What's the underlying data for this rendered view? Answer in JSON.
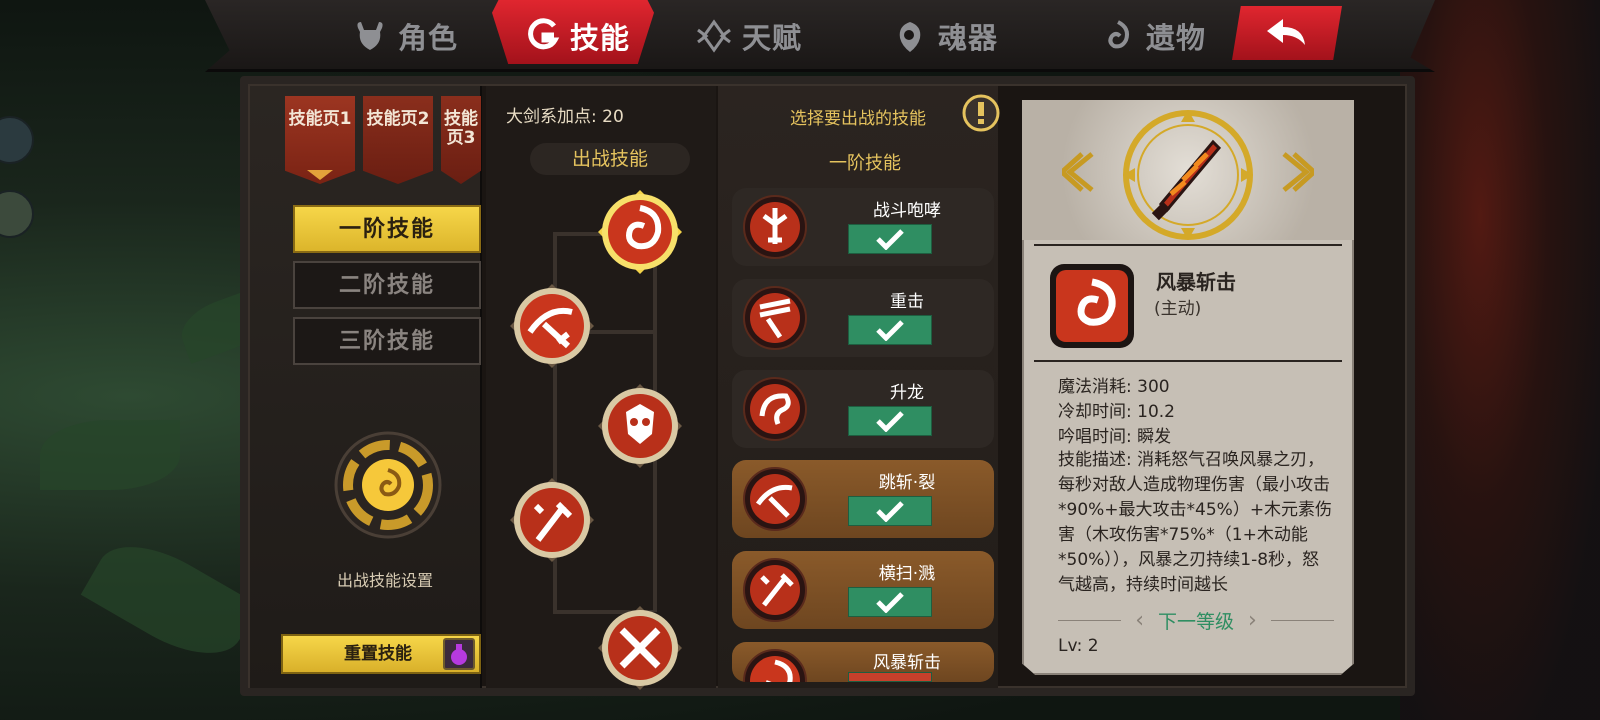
{
  "nav": {
    "tabs": [
      {
        "label": "角色",
        "icon": "horned-helmet-icon"
      },
      {
        "label": "技能",
        "icon": "skill-g-icon"
      },
      {
        "label": "天赋",
        "icon": "crystal-icon"
      },
      {
        "label": "魂器",
        "icon": "soul-drop-icon"
      },
      {
        "label": "遗物",
        "icon": "relic-swirl-icon"
      }
    ],
    "active_tab": "技能",
    "back_icon": "back-arrow-icon"
  },
  "left": {
    "pages": [
      {
        "label": "技能页1",
        "selected": true
      },
      {
        "label": "技能页2",
        "selected": false
      },
      {
        "label": "技能页3",
        "selected": false,
        "locked": true
      }
    ],
    "tiers": [
      {
        "label": "一阶技能",
        "selected": true
      },
      {
        "label": "二阶技能",
        "selected": false
      },
      {
        "label": "三阶技能",
        "selected": false
      }
    ],
    "battle_settings_label": "出战技能设置",
    "reset_label": "重置技能",
    "reset_icon": "potion-icon"
  },
  "tree": {
    "points_text": "大剑系加点: 20",
    "battle_header": "出战技能"
  },
  "list": {
    "select_text": "选择要出战的技能",
    "tier_title": "一阶技能",
    "skills": [
      {
        "name": "战斗咆哮",
        "equipped": true,
        "icon": "war-cry-icon",
        "style": "dark"
      },
      {
        "name": "重击",
        "equipped": true,
        "icon": "heavy-strike-icon",
        "style": "dark"
      },
      {
        "name": "升龙",
        "equipped": true,
        "icon": "rising-dragon-icon",
        "style": "dark"
      },
      {
        "name": "跳斩·裂",
        "equipped": true,
        "icon": "leap-slash-icon",
        "style": "amber"
      },
      {
        "name": "横扫·溅",
        "equipped": true,
        "icon": "sweep-icon",
        "style": "amber"
      },
      {
        "name": "风暴斩击",
        "equipped": false,
        "icon": "storm-slash-icon",
        "style": "amber"
      }
    ]
  },
  "detail": {
    "name": "风暴斩击",
    "type": "(主动)",
    "stats": [
      {
        "label": "魔法消耗:",
        "value": "300"
      },
      {
        "label": "冷却时间:",
        "value": "10.2"
      },
      {
        "label": "吟唱时间:",
        "value": "瞬发"
      }
    ],
    "description": "技能描述: 消耗怒气召唤风暴之刃，每秒对敌人造成物理伤害（最小攻击*90%+最大攻击*45%）+木元素伤害（木攻伤害*75%*（1+木动能*50%）），风暴之刃持续1-8秒，怒气越高，持续时间越长",
    "next_level": "下一等级",
    "level": "Lv: 2"
  },
  "colors": {
    "accent_red": "#e0262f",
    "gold": "#f6d649",
    "check_green": "#2f8e62"
  }
}
